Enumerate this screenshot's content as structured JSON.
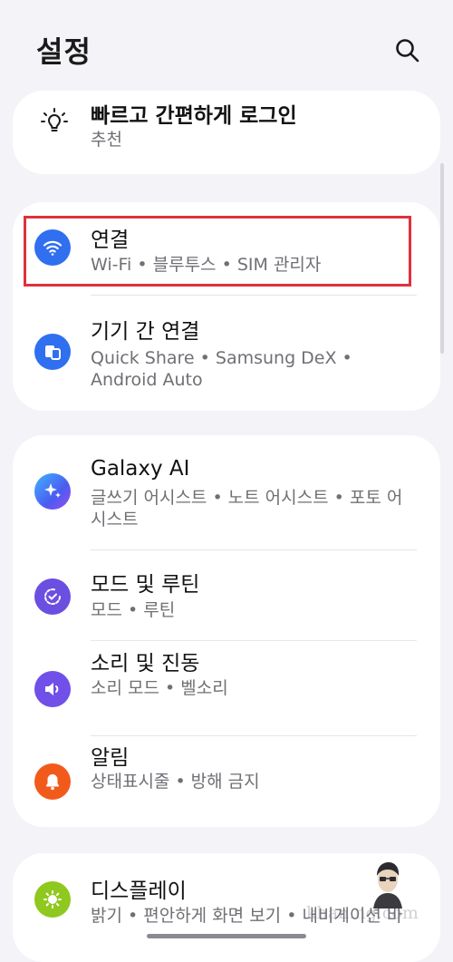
{
  "header": {
    "title": "설정",
    "search_icon": "search-icon"
  },
  "cards": [
    {
      "items": [
        {
          "id": "quick-login",
          "icon": "lightbulb-icon",
          "title": "빠르고 간편하게 로그인",
          "subtitle": "추천"
        }
      ]
    },
    {
      "items": [
        {
          "id": "connections",
          "icon": "wifi-icon",
          "color": "#2f6ff0",
          "title": "연결",
          "subtitle": "Wi-Fi • 블루투스 • SIM 관리자",
          "highlighted": true
        },
        {
          "id": "connected-devices",
          "icon": "devices-icon",
          "color": "#2f6ff0",
          "title": "기기 간 연결",
          "subtitle": "Quick Share • Samsung DeX • Android Auto"
        }
      ]
    },
    {
      "items": [
        {
          "id": "galaxy-ai",
          "icon": "sparkle-icon",
          "color": "#4a86f0",
          "title": "Galaxy AI",
          "subtitle": "글쓰기 어시스트 • 노트 어시스트 • 포토 어시스트"
        },
        {
          "id": "modes-routines",
          "icon": "routine-icon",
          "color": "#6b4fe0",
          "title": "모드 및 루틴",
          "subtitle": "모드 • 루틴"
        },
        {
          "id": "sound-vibration",
          "icon": "speaker-icon",
          "color": "#7050e8",
          "title": "소리 및 진동",
          "subtitle": "소리 모드 • 벨소리"
        },
        {
          "id": "notifications",
          "icon": "bell-icon",
          "color": "#f25a1c",
          "title": "알림",
          "subtitle": "상태표시줄 • 방해 금지"
        }
      ]
    },
    {
      "items": [
        {
          "id": "display",
          "icon": "sun-icon",
          "color": "#8fc81e",
          "title": "디스플레이",
          "subtitle": "밝기 • 편안하게 화면 보기 • 내비게이션 바"
        }
      ]
    }
  ],
  "watermark": "khan.ng.com"
}
